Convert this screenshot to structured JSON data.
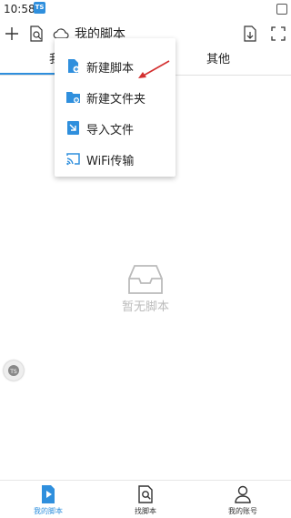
{
  "status_bar": {
    "time": "10:58",
    "app_badge": "TS"
  },
  "toolbar": {
    "title": "我的脚本",
    "icons": [
      "plus-icon",
      "scan-file-icon",
      "cloud-icon",
      "import-file-icon",
      "fullscreen-icon"
    ]
  },
  "tabs": [
    {
      "label": "我的脚本",
      "active": true
    },
    {
      "label": "其他",
      "active": false
    }
  ],
  "menu": {
    "items": [
      {
        "label": "新建脚本",
        "icon": "new-script-icon"
      },
      {
        "label": "新建文件夹",
        "icon": "new-folder-icon"
      },
      {
        "label": "导入文件",
        "icon": "import-icon"
      },
      {
        "label": "WiFi传输",
        "icon": "cast-icon"
      }
    ]
  },
  "empty_state": {
    "label": "暂无脚本",
    "icon": "inbox-icon"
  },
  "floating_ball": {
    "label": "TS"
  },
  "bottom_nav": {
    "items": [
      {
        "label": "我的脚本",
        "icon": "play-file-icon",
        "active": true
      },
      {
        "label": "找脚本",
        "icon": "search-file-icon",
        "active": false
      },
      {
        "label": "我的账号",
        "icon": "user-icon",
        "active": false
      }
    ]
  },
  "colors": {
    "accent": "#2f8fdd",
    "annotation_arrow": "#d32f2f"
  }
}
